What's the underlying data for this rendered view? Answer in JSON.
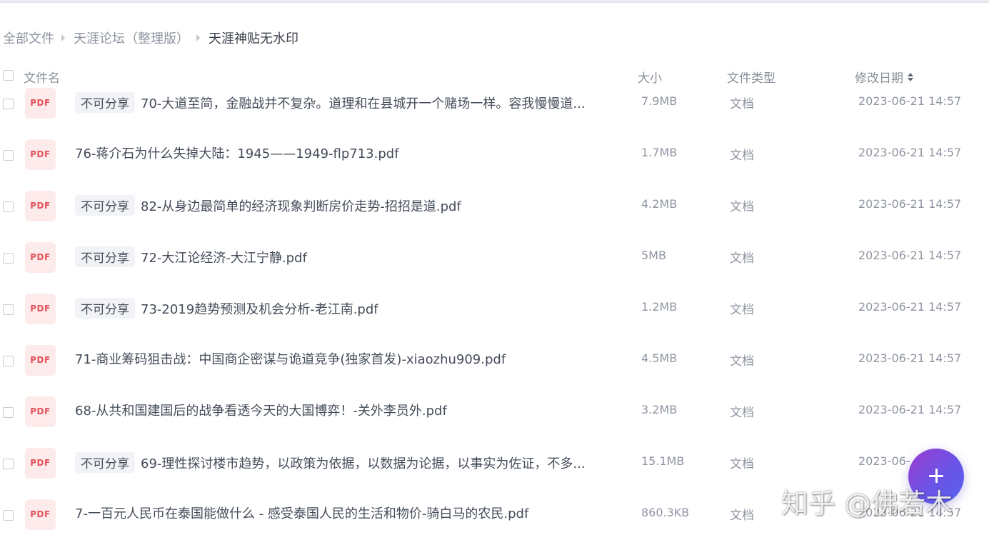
{
  "breadcrumb": {
    "root": "全部文件",
    "parent": "天涯论坛（整理版）",
    "current": "天涯神贴无水印"
  },
  "columns": {
    "name": "文件名",
    "size": "大小",
    "type": "文件类型",
    "modified": "修改日期"
  },
  "file_icon_label": "PDF",
  "files": [
    {
      "badge": "不可分享",
      "name": "70-大道至简，金融战并不复杂。道理和在县城开一个赌场一样。容我慢慢道...",
      "size": "7.9MB",
      "type": "文档",
      "date": "2023-06-21 14:57"
    },
    {
      "badge": "",
      "name": "76-蒋介石为什么失掉大陆：1945——1949-flp713.pdf",
      "size": "1.7MB",
      "type": "文档",
      "date": "2023-06-21 14:57"
    },
    {
      "badge": "不可分享",
      "name": "82-从身边最简单的经济现象判断房价走势-招招是道.pdf",
      "size": "4.2MB",
      "type": "文档",
      "date": "2023-06-21 14:57"
    },
    {
      "badge": "不可分享",
      "name": "72-大江论经济-大江宁静.pdf",
      "size": "5MB",
      "type": "文档",
      "date": "2023-06-21 14:57"
    },
    {
      "badge": "不可分享",
      "name": "73-2019趋势预测及机会分析-老江南.pdf",
      "size": "1.2MB",
      "type": "文档",
      "date": "2023-06-21 14:57"
    },
    {
      "badge": "",
      "name": "71-商业筹码狙击战：中国商企密谋与诡道竞争(独家首发)-xiaozhu909.pdf",
      "size": "4.5MB",
      "type": "文档",
      "date": "2023-06-21 14:57"
    },
    {
      "badge": "",
      "name": "68-从共和国建国后的战争看透今天的大国博弈！-关外李员外.pdf",
      "size": "3.2MB",
      "type": "文档",
      "date": "2023-06-21 14:57"
    },
    {
      "badge": "不可分享",
      "name": "69-理性探讨楼市趋势，以政策为依据，以数据为论据，以事实为佐证，不多...",
      "size": "15.1MB",
      "type": "文档",
      "date": "2023-06-"
    },
    {
      "badge": "",
      "name": "7-一百元人民币在泰国能做什么 - 感受泰国人民的生活和物价-骑白马的农民.pdf",
      "size": "860.3KB",
      "type": "文档",
      "date": "2023-06-21 14:57"
    }
  ],
  "watermark": "知乎 @佛若木",
  "icons": {
    "fab": "plus-icon",
    "sort": "sort-icon",
    "file": "pdf-icon"
  },
  "colors": {
    "pdf_bg": "#fdebeb",
    "pdf_text": "#e4525a",
    "fab_gradient_start": "#9b3dd0",
    "fab_gradient_end": "#5563f0"
  }
}
